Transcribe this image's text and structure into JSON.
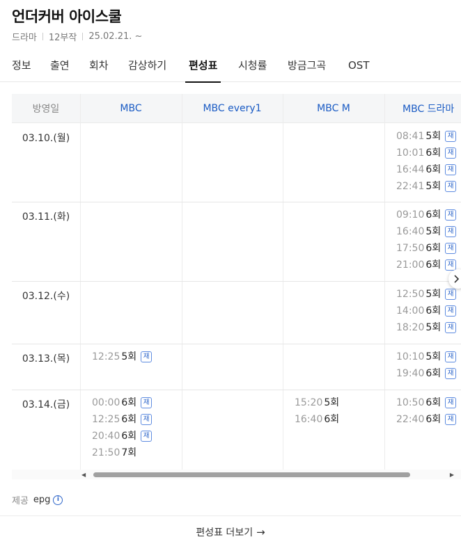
{
  "title": "언더커버 아이스쿨",
  "meta": {
    "genre": "드라마",
    "episodes": "12부작",
    "date": "25.02.21. ~"
  },
  "tabs": [
    "정보",
    "출연",
    "회차",
    "감상하기",
    "편성표",
    "시청률",
    "방금그곡",
    "OST"
  ],
  "active_tab": "편성표",
  "schedule": {
    "date_header": "방영일",
    "channels": [
      "MBC",
      "MBC every1",
      "MBC M",
      "MBC 드라마"
    ],
    "rerun_badge": "재",
    "rows": [
      {
        "date": "03.10.(월)",
        "slots": [
          [],
          [],
          [],
          [
            {
              "time": "08:41",
              "ep": "5회",
              "rerun": true
            },
            {
              "time": "10:01",
              "ep": "6회",
              "rerun": true
            },
            {
              "time": "16:44",
              "ep": "6회",
              "rerun": true
            },
            {
              "time": "22:41",
              "ep": "5회",
              "rerun": true
            }
          ]
        ]
      },
      {
        "date": "03.11.(화)",
        "slots": [
          [],
          [],
          [],
          [
            {
              "time": "09:10",
              "ep": "6회",
              "rerun": true
            },
            {
              "time": "16:40",
              "ep": "5회",
              "rerun": true
            },
            {
              "time": "17:50",
              "ep": "6회",
              "rerun": true
            },
            {
              "time": "21:00",
              "ep": "6회",
              "rerun": true
            }
          ]
        ]
      },
      {
        "date": "03.12.(수)",
        "slots": [
          [],
          [],
          [],
          [
            {
              "time": "12:50",
              "ep": "5회",
              "rerun": true
            },
            {
              "time": "14:00",
              "ep": "6회",
              "rerun": true
            },
            {
              "time": "18:20",
              "ep": "5회",
              "rerun": true
            }
          ]
        ]
      },
      {
        "date": "03.13.(목)",
        "slots": [
          [
            {
              "time": "12:25",
              "ep": "5회",
              "rerun": true
            }
          ],
          [],
          [],
          [
            {
              "time": "10:10",
              "ep": "5회",
              "rerun": true
            },
            {
              "time": "19:40",
              "ep": "6회",
              "rerun": true
            }
          ]
        ]
      },
      {
        "date": "03.14.(금)",
        "slots": [
          [
            {
              "time": "00:00",
              "ep": "6회",
              "rerun": true
            },
            {
              "time": "12:25",
              "ep": "6회",
              "rerun": true
            },
            {
              "time": "20:40",
              "ep": "6회",
              "rerun": true
            },
            {
              "time": "21:50",
              "ep": "7회",
              "rerun": false
            }
          ],
          [],
          [
            {
              "time": "15:20",
              "ep": "5회",
              "rerun": false
            },
            {
              "time": "16:40",
              "ep": "6회",
              "rerun": false
            }
          ],
          [
            {
              "time": "10:50",
              "ep": "6회",
              "rerun": true
            },
            {
              "time": "22:40",
              "ep": "6회",
              "rerun": true
            }
          ]
        ]
      }
    ]
  },
  "provider": {
    "label": "제공",
    "name": "epg"
  },
  "more_button": "편성표 더보기"
}
